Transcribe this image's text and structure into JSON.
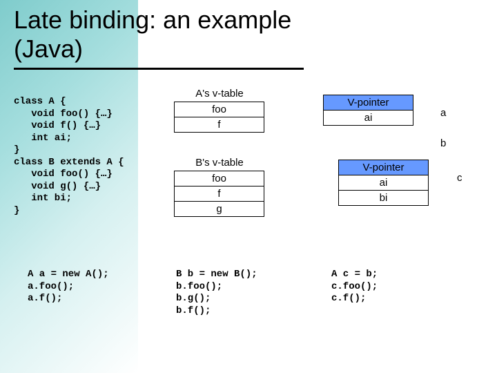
{
  "title_line1": "Late binding: an example",
  "title_line2": "(Java)",
  "code_classes": "class A {\n   void foo() {…}\n   void f() {…}\n   int ai;\n}\nclass B extends A {\n   void foo() {…}\n   void g() {…}\n   int bi;\n}",
  "vtable_a": {
    "label": "A's v-table",
    "rows": [
      "foo",
      "f"
    ]
  },
  "vtable_b": {
    "label": "B's v-table",
    "rows": [
      "foo",
      "f",
      "g"
    ]
  },
  "object_a": {
    "rows": [
      "V-pointer",
      "ai"
    ],
    "side_label": "a"
  },
  "object_b": {
    "rows": [
      "V-pointer",
      "ai",
      "bi"
    ],
    "side_labels": [
      "b",
      "c"
    ]
  },
  "code_a": "A a = new A();\na.foo();\na.f();",
  "code_b": "B b = new B();\nb.foo();\nb.g();\nb.f();",
  "code_c": "A c = b;\nc.foo();\nc.f();"
}
